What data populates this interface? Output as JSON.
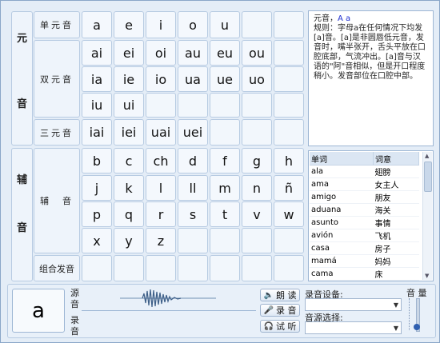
{
  "sections": {
    "vowel": [
      "元",
      "音"
    ],
    "consonant": [
      "辅",
      "音"
    ]
  },
  "rows": {
    "single": "单元音",
    "double": "双元音",
    "triple": "三元音",
    "cons": "辅　音",
    "combo": "组合发音"
  },
  "keys": {
    "single": [
      "a",
      "e",
      "i",
      "o",
      "u"
    ],
    "double1": [
      "ai",
      "ei",
      "oi",
      "au",
      "eu",
      "ou"
    ],
    "double2": [
      "ia",
      "ie",
      "io",
      "ua",
      "ue",
      "uo"
    ],
    "double3": [
      "iu",
      "ui"
    ],
    "triple": [
      "iai",
      "iei",
      "uai",
      "uei"
    ],
    "cons1": [
      "b",
      "c",
      "ch",
      "d",
      "f",
      "g",
      "h"
    ],
    "cons2": [
      "j",
      "k",
      "l",
      "ll",
      "m",
      "n",
      "ñ"
    ],
    "cons3": [
      "p",
      "q",
      "r",
      "s",
      "t",
      "v",
      "w"
    ],
    "cons4": [
      "x",
      "y",
      "z"
    ]
  },
  "info": {
    "title_prefix": "元音，",
    "title_letters": "A a",
    "body": "规则：字母a在任何情况下均发[a]音。[a]是非圆唇低元音，发音时，嘴半张开，舌头平放在口腔底部，气流冲出。[a]音与汉语的\"阿\"音相似，但是开口程度稍小。发音部位在口腔中部。"
  },
  "words": {
    "headers": [
      "单词",
      "词意"
    ],
    "rows": [
      [
        "ala",
        "翅膀"
      ],
      [
        "ama",
        "女主人"
      ],
      [
        "amigo",
        "朋友"
      ],
      [
        "aduana",
        "海关"
      ],
      [
        "asunto",
        "事情"
      ],
      [
        "avión",
        "飞机"
      ],
      [
        "casa",
        "房子"
      ],
      [
        "mamá",
        "妈妈"
      ],
      [
        "cama",
        "床"
      ]
    ]
  },
  "bottom": {
    "current_letter": "a",
    "source_label": "源音",
    "record_label": "录音",
    "btn_read": "朗 读",
    "btn_record": "录 音",
    "btn_listen": "试 听",
    "rec_device": "录音设备:",
    "src_select": "音源选择:",
    "volume": "音 量"
  }
}
